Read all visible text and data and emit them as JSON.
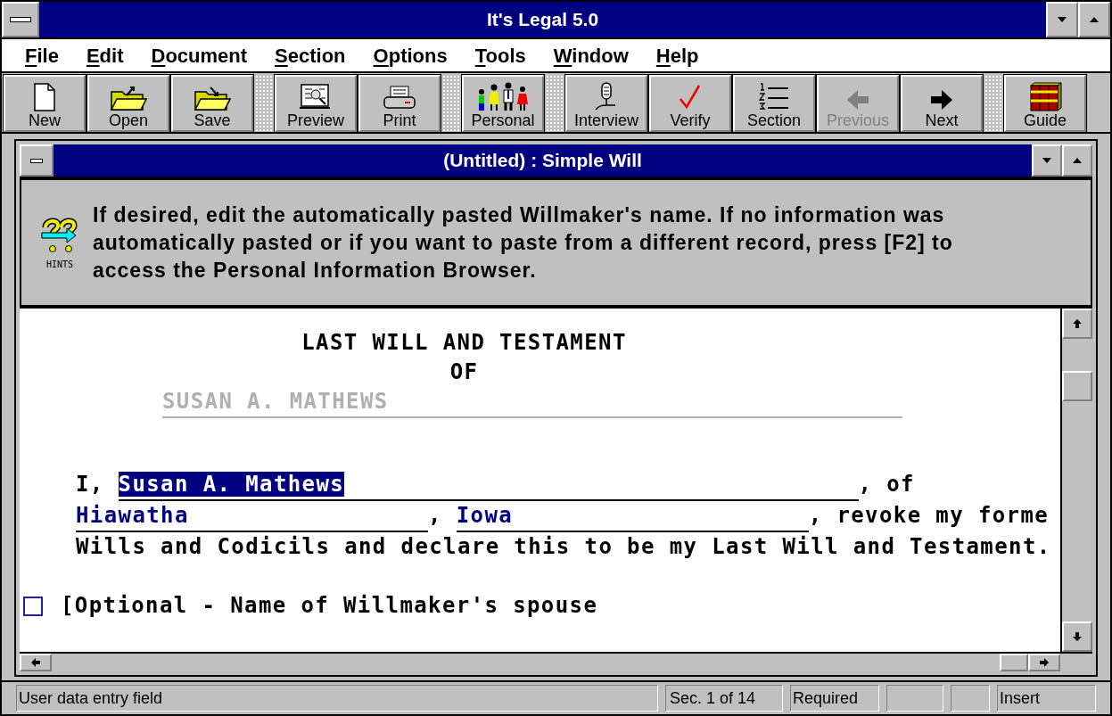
{
  "window": {
    "title": "It's Legal 5.0"
  },
  "menu": [
    {
      "label": "File"
    },
    {
      "label": "Edit"
    },
    {
      "label": "Document"
    },
    {
      "label": "Section"
    },
    {
      "label": "Options"
    },
    {
      "label": "Tools"
    },
    {
      "label": "Window"
    },
    {
      "label": "Help"
    }
  ],
  "toolbar": [
    [
      {
        "label": "New",
        "disabled": false
      },
      {
        "label": "Open",
        "disabled": false
      },
      {
        "label": "Save",
        "disabled": false
      }
    ],
    [
      {
        "label": "Preview",
        "disabled": false
      },
      {
        "label": "Print",
        "disabled": false
      }
    ],
    [
      {
        "label": "Personal",
        "disabled": false
      }
    ],
    [
      {
        "label": "Interview",
        "disabled": false
      },
      {
        "label": "Verify",
        "disabled": false
      },
      {
        "label": "Section",
        "disabled": false
      },
      {
        "label": "Previous",
        "disabled": true
      },
      {
        "label": "Next",
        "disabled": false
      }
    ],
    [
      {
        "label": "Guide",
        "disabled": false
      }
    ]
  ],
  "document_window": {
    "title": "(Untitled) : Simple Will",
    "hints": {
      "icon_label": "HINTS",
      "text": "If desired, edit the automatically pasted Willmaker's name. If no information was automatically pasted or if you want to paste from a different record, press [F2] to access the Personal Information Browser."
    },
    "heading": [
      "LAST WILL AND TESTAMENT",
      "OF"
    ],
    "name_line": {
      "value": "SUSAN A. MATHEWS",
      "disabled": true
    },
    "paragraph": [
      [
        {
          "kind": "text",
          "text": "I, "
        },
        {
          "kind": "field",
          "value": "Susan A. Mathews",
          "selected": true
        },
        {
          "kind": "text",
          "text": ", of"
        }
      ],
      [
        {
          "kind": "field",
          "value": "Hiawatha",
          "selected": false
        },
        {
          "kind": "text",
          "text": ", "
        },
        {
          "kind": "field",
          "value": "Iowa",
          "selected": false
        },
        {
          "kind": "text",
          "text": ", revoke my forme"
        }
      ],
      [
        {
          "kind": "text",
          "text": "Wills and Codicils and declare this to be my Last Will and Testament."
        }
      ]
    ],
    "optional": {
      "checked": false,
      "text": "[Optional - Name of Willmaker's spouse"
    }
  },
  "status_bar": {
    "message": "User data entry field",
    "section": "Sec. 1 of 14",
    "requirement": "Required",
    "mode": "Insert"
  }
}
